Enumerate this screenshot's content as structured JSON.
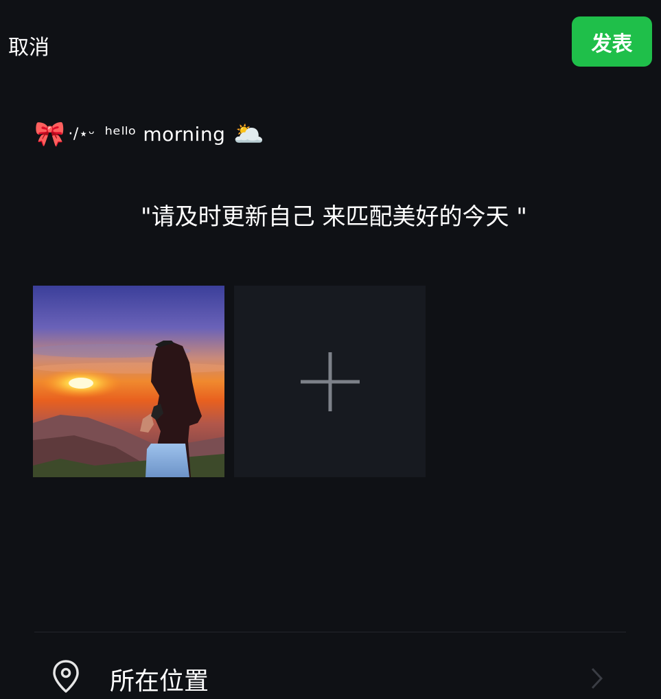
{
  "header": {
    "cancel_label": "取消",
    "publish_label": "发表",
    "publish_color": "#1fbf4a"
  },
  "post": {
    "line1_bow": "🎀",
    "line1_deco": "·/⋆ᵕ",
    "line1_text": "ʰᵉˡˡᵒ morning",
    "line1_cloud": "🌥️",
    "line2_text": "\"请及时更新自己 来匹配美好的今天 \""
  },
  "media": {
    "add_icon": "plus-icon"
  },
  "location": {
    "icon": "location-pin-icon",
    "label": "所在位置",
    "chevron": "chevron-right-icon"
  }
}
